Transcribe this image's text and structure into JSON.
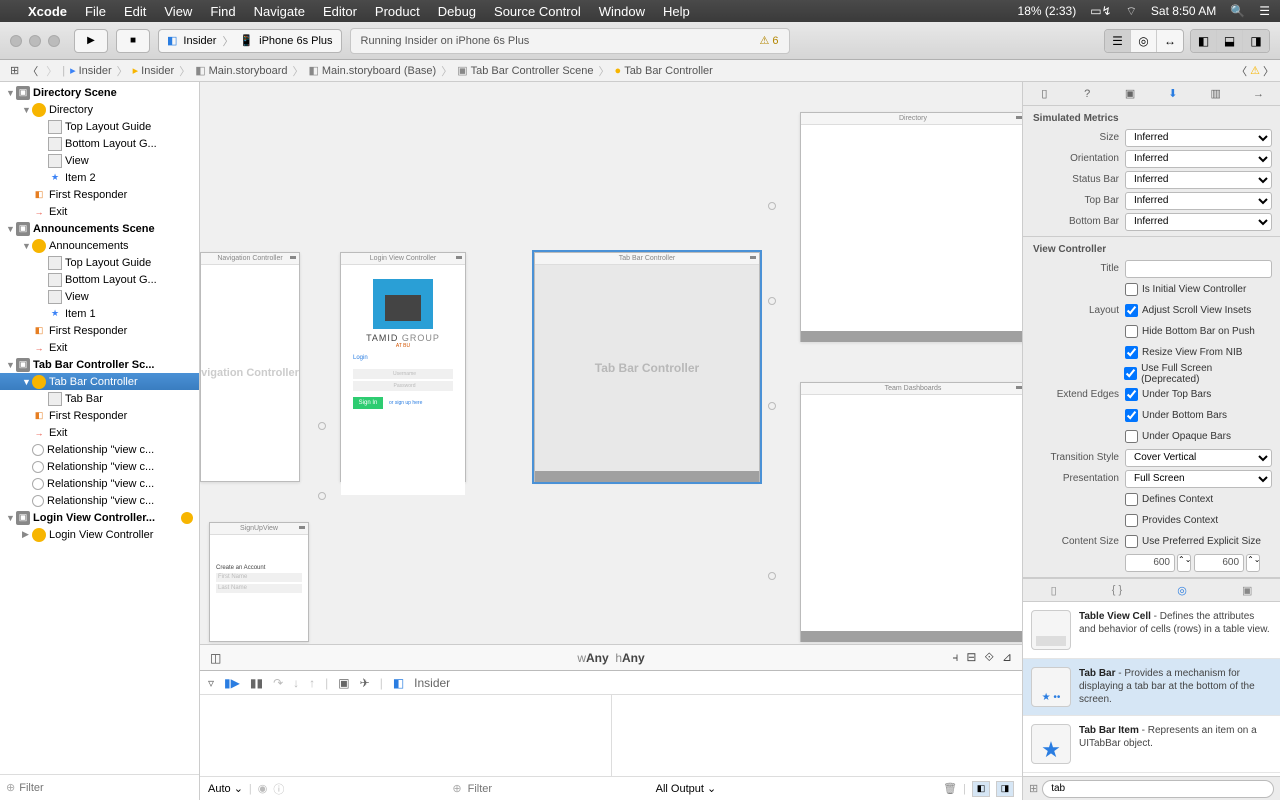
{
  "menubar": {
    "app": "Xcode",
    "items": [
      "File",
      "Edit",
      "View",
      "Find",
      "Navigate",
      "Editor",
      "Product",
      "Debug",
      "Source Control",
      "Window",
      "Help"
    ],
    "battery": "18% (2:33)",
    "clock": "Sat 8:50 AM"
  },
  "toolbar": {
    "scheme_app": "Insider",
    "scheme_dev": "iPhone 6s Plus",
    "status": "Running Insider on iPhone 6s Plus",
    "warn_count": "6"
  },
  "jumpbar": {
    "items": [
      "Insider",
      "Insider",
      "Main.storyboard",
      "Main.storyboard (Base)",
      "Tab Bar Controller Scene",
      "Tab Bar Controller"
    ]
  },
  "navigator": {
    "filter_placeholder": "Filter",
    "tree": [
      {
        "d": 0,
        "t": "Directory Scene",
        "k": "scene",
        "disc": "▼"
      },
      {
        "d": 1,
        "t": "Directory",
        "k": "vc",
        "disc": "▼"
      },
      {
        "d": 2,
        "t": "Top Layout Guide",
        "k": "view"
      },
      {
        "d": 2,
        "t": "Bottom Layout G...",
        "k": "view"
      },
      {
        "d": 2,
        "t": "View",
        "k": "view"
      },
      {
        "d": 2,
        "t": "Item 2",
        "k": "item"
      },
      {
        "d": 1,
        "t": "First Responder",
        "k": "resp"
      },
      {
        "d": 1,
        "t": "Exit",
        "k": "exit"
      },
      {
        "d": 0,
        "t": "Announcements Scene",
        "k": "scene",
        "disc": "▼"
      },
      {
        "d": 1,
        "t": "Announcements",
        "k": "vc",
        "disc": "▼"
      },
      {
        "d": 2,
        "t": "Top Layout Guide",
        "k": "view"
      },
      {
        "d": 2,
        "t": "Bottom Layout G...",
        "k": "view"
      },
      {
        "d": 2,
        "t": "View",
        "k": "view"
      },
      {
        "d": 2,
        "t": "Item 1",
        "k": "item"
      },
      {
        "d": 1,
        "t": "First Responder",
        "k": "resp"
      },
      {
        "d": 1,
        "t": "Exit",
        "k": "exit"
      },
      {
        "d": 0,
        "t": "Tab Bar Controller Sc...",
        "k": "scene",
        "disc": "▼"
      },
      {
        "d": 1,
        "t": "Tab Bar Controller",
        "k": "vc",
        "disc": "▼",
        "sel": true
      },
      {
        "d": 2,
        "t": "Tab Bar",
        "k": "view"
      },
      {
        "d": 1,
        "t": "First Responder",
        "k": "resp"
      },
      {
        "d": 1,
        "t": "Exit",
        "k": "exit"
      },
      {
        "d": 1,
        "t": "Relationship \"view c...",
        "k": "rel"
      },
      {
        "d": 1,
        "t": "Relationship \"view c...",
        "k": "rel"
      },
      {
        "d": 1,
        "t": "Relationship \"view c...",
        "k": "rel"
      },
      {
        "d": 1,
        "t": "Relationship \"view c...",
        "k": "rel"
      },
      {
        "d": 0,
        "t": "Login View Controller...",
        "k": "scene",
        "disc": "▼",
        "hl": true
      },
      {
        "d": 1,
        "t": "Login View Controller",
        "k": "vc",
        "disc": "▶"
      }
    ]
  },
  "canvas": {
    "scenes": {
      "nav": "Navigation Controller",
      "login": "Login View Controller",
      "tabbar": "Tab Bar Controller",
      "directory": "Directory",
      "team": "Team Dashboards",
      "signup": "SignUpView"
    },
    "login": {
      "brand1": "TAMID ",
      "brand2": "GROUP",
      "sub": "AT BU",
      "heading": "Login",
      "user_ph": "Username",
      "pass_ph": "Password",
      "signin": "Sign In",
      "alt": "or sign up here"
    },
    "signup": {
      "title": "Create an Account",
      "ph1": "First Name",
      "ph2": "Last Name"
    },
    "navbody": "vigation Controller",
    "footer": {
      "w": "w",
      "h": "h",
      "any": "Any"
    }
  },
  "debug": {
    "process": "Insider",
    "auto": "Auto",
    "filter_placeholder": "Filter",
    "output": "All Output"
  },
  "inspector": {
    "sec1": "Simulated Metrics",
    "metrics": {
      "size_l": "Size",
      "size_v": "Inferred",
      "orient_l": "Orientation",
      "orient_v": "Inferred",
      "status_l": "Status Bar",
      "status_v": "Inferred",
      "top_l": "Top Bar",
      "top_v": "Inferred",
      "bot_l": "Bottom Bar",
      "bot_v": "Inferred"
    },
    "sec2": "View Controller",
    "vc": {
      "title_l": "Title",
      "initial_l": "Is Initial View Controller",
      "layout_l": "Layout",
      "layout_opts": [
        "Adjust Scroll View Insets",
        "Hide Bottom Bar on Push",
        "Resize View From NIB",
        "Use Full Screen (Deprecated)"
      ],
      "layout_checked": [
        true,
        false,
        true,
        true
      ],
      "extend_l": "Extend Edges",
      "extend_opts": [
        "Under Top Bars",
        "Under Bottom Bars",
        "Under Opaque Bars"
      ],
      "extend_checked": [
        true,
        true,
        false
      ],
      "trans_l": "Transition Style",
      "trans_v": "Cover Vertical",
      "pres_l": "Presentation",
      "pres_v": "Full Screen",
      "defines_l": "Defines Context",
      "provides_l": "Provides Context",
      "csize_l": "Content Size",
      "csize_cb": "Use Preferred Explicit Size",
      "csize_w": "600",
      "csize_h": "600"
    },
    "library": {
      "items": [
        {
          "name": "Table View Cell",
          "desc": " - Defines the attributes and behavior of cells (rows) in a table view."
        },
        {
          "name": "Tab Bar",
          "desc": " - Provides a mechanism for displaying a tab bar at the bottom of the screen.",
          "sel": true
        },
        {
          "name": "Tab Bar Item",
          "desc": " - Represents an item on a UITabBar object."
        }
      ],
      "filter": "tab"
    }
  }
}
